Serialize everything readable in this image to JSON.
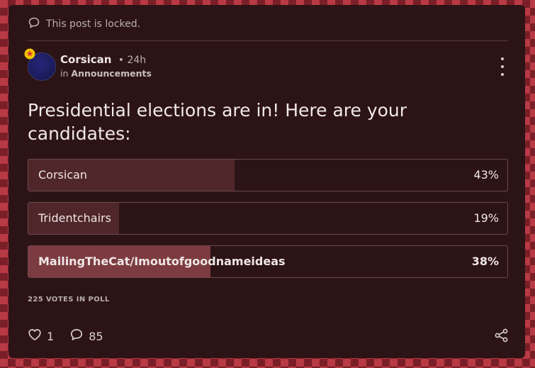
{
  "post": {
    "locked_text": "This post is locked.",
    "author": {
      "name": "Corsican",
      "time": "24h",
      "category_prefix": "in",
      "category": "Announcements"
    },
    "title": "Presidential elections are in! Here are your candidates:"
  },
  "poll": {
    "options": [
      {
        "label": "Corsican",
        "percent_text": "43%",
        "percent": 43,
        "selected": false
      },
      {
        "label": "Tridentchairs",
        "percent_text": "19%",
        "percent": 19,
        "selected": false
      },
      {
        "label": "MailingTheCat/Imoutofgoodnameideas",
        "percent_text": "38%",
        "percent": 38,
        "selected": true
      }
    ],
    "votes_text": "225 VOTES IN POLL"
  },
  "actions": {
    "likes": "1",
    "comments": "85"
  },
  "icons": {
    "locked": "chat-bubble-icon",
    "badge": "star-badge-icon",
    "more": "more-vertical-icon",
    "like": "heart-icon",
    "comment": "comment-icon",
    "share": "share-icon"
  },
  "colors": {
    "card_bg": "#2c1316",
    "bar_fill": "#4f2629",
    "bar_fill_selected": "#7c3b40",
    "badge": "#f2c200",
    "badge_inner": "#d83a2a"
  }
}
